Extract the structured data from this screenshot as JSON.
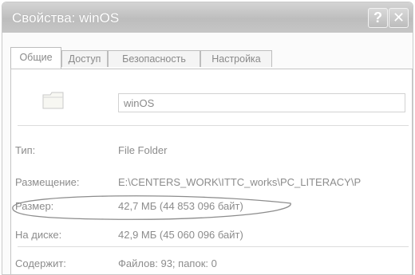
{
  "window": {
    "title": "Свойства: winOS"
  },
  "titlebar": {
    "help_label": "?",
    "close_label": "✕"
  },
  "tabs": [
    {
      "label": "Общие",
      "active": true
    },
    {
      "label": "Доступ",
      "active": false
    },
    {
      "label": "Безопасность",
      "active": false
    },
    {
      "label": "Настройка",
      "active": false
    }
  ],
  "general": {
    "folder_name": "winOS",
    "folder_icon": "folder-icon",
    "rows": [
      {
        "label": "Тип:",
        "value": "File Folder"
      },
      {
        "label": "Размещение:",
        "value": "E:\\CENTERS_WORK\\ITTC_works\\PC_LITERACY\\P"
      },
      {
        "label": "Размер:",
        "value": "42,7 МБ (44 853 096 байт)"
      },
      {
        "label": "На диске:",
        "value": "42,9 МБ (45 060 096 байт)"
      },
      {
        "label": "Содержит:",
        "value": "Файлов: 93; папок: 0"
      }
    ]
  },
  "colors": {
    "highlight_ellipse": "#8c8c8c",
    "titlebar": "#c6c6c6"
  }
}
